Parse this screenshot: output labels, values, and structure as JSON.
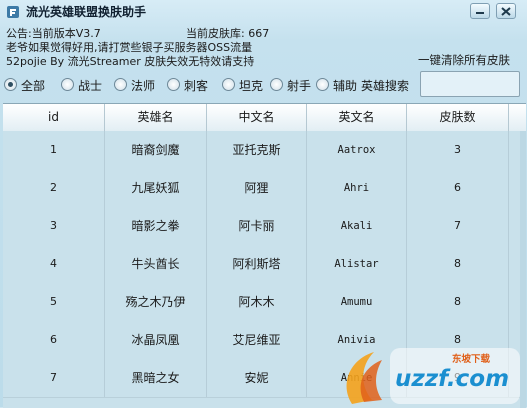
{
  "window": {
    "title": "流光英雄联盟换肤助手"
  },
  "info": {
    "announcement": "公告:当前版本V3.7",
    "skin_library": "当前皮肤库: 667",
    "line2": "老爷如果觉得好用,请打赏些银子买服务器OSS流量",
    "line3": "52pojie By 流光Streamer 皮肤失效无特效请支持"
  },
  "clear_all_label": "一键清除所有皮肤",
  "filters": [
    {
      "label": "全部",
      "selected": true
    },
    {
      "label": "战士",
      "selected": false
    },
    {
      "label": "法师",
      "selected": false
    },
    {
      "label": "刺客",
      "selected": false
    },
    {
      "label": "坦克",
      "selected": false
    },
    {
      "label": "射手",
      "selected": false
    },
    {
      "label": "辅助",
      "selected": false
    }
  ],
  "search": {
    "label": "英雄搜索",
    "value": ""
  },
  "table": {
    "headers": [
      "id",
      "英雄名",
      "中文名",
      "英文名",
      "皮肤数"
    ],
    "rows": [
      [
        "1",
        "暗裔剑魔",
        "亚托克斯",
        "Aatrox",
        "3"
      ],
      [
        "2",
        "九尾妖狐",
        "阿狸",
        "Ahri",
        "6"
      ],
      [
        "3",
        "暗影之拳",
        "阿卡丽",
        "Akali",
        "7"
      ],
      [
        "4",
        "牛头酋长",
        "阿利斯塔",
        "Alistar",
        "8"
      ],
      [
        "5",
        "殇之木乃伊",
        "阿木木",
        "Amumu",
        "8"
      ],
      [
        "6",
        "冰晶凤凰",
        "艾尼维亚",
        "Anivia",
        "8"
      ],
      [
        "7",
        "黑暗之女",
        "安妮",
        "Annie",
        "9"
      ]
    ]
  },
  "watermark": {
    "text": "uzzf.com",
    "sub": "东坡下载"
  },
  "colors": {
    "accent": "#1b8fd0",
    "background": "#c9e1eb"
  }
}
